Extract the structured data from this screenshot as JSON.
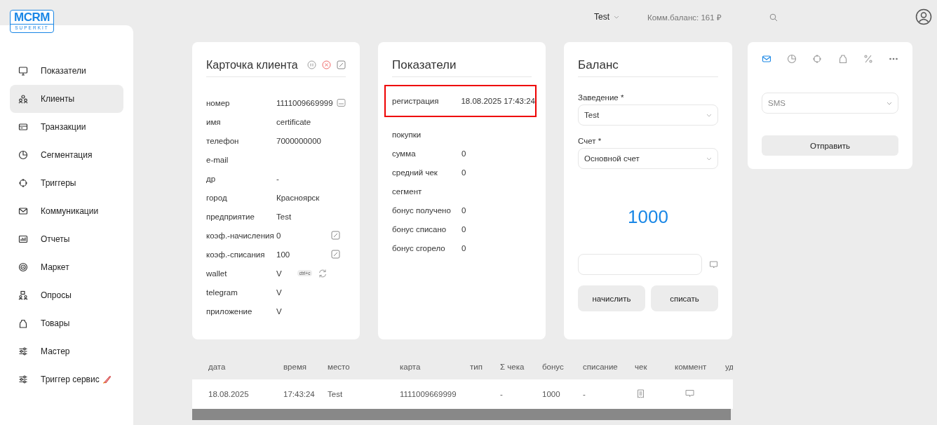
{
  "header": {
    "company": "Test",
    "balance": "Комм.баланс: 161 ₽"
  },
  "logo": {
    "title": "MCRM",
    "subtitle": "SUPERKIT"
  },
  "sidebar": {
    "items": [
      {
        "label": "Показатели",
        "selected": false
      },
      {
        "label": "Клиенты",
        "selected": true
      },
      {
        "label": "Транзакции",
        "selected": false
      },
      {
        "label": "Сегментация",
        "selected": false
      },
      {
        "label": "Триггеры",
        "selected": false
      },
      {
        "label": "Коммуникации",
        "selected": false
      },
      {
        "label": "Отчеты",
        "selected": false
      },
      {
        "label": "Маркет",
        "selected": false
      },
      {
        "label": "Опросы",
        "selected": false
      },
      {
        "label": "Товары",
        "selected": false
      },
      {
        "label": "Мастер",
        "selected": false
      },
      {
        "label": "Триггер сервис",
        "selected": false
      }
    ]
  },
  "client_card": {
    "title": "Карточка клиента",
    "fields": [
      {
        "label": "номер",
        "value": "1111009669999",
        "kind": "card"
      },
      {
        "label": "имя",
        "value": "certificate",
        "kind": "plain"
      },
      {
        "label": "телефон",
        "value": "7000000000",
        "kind": "plain"
      },
      {
        "label": "e-mail",
        "kind": "plain"
      },
      {
        "label": "др",
        "value": "-",
        "kind": "plain"
      },
      {
        "label": "город",
        "value": "Красноярск",
        "kind": "plain"
      },
      {
        "label": "предприятие",
        "value": "Test",
        "kind": "plain"
      },
      {
        "label": "коэф.-начисления",
        "value": "0",
        "kind": "edit"
      },
      {
        "label": "коэф.-списания",
        "value": "100",
        "kind": "edit"
      },
      {
        "label": "wallet",
        "value": "V",
        "kind": "wallet",
        "badge": "ctrl+c"
      },
      {
        "label": "telegram",
        "value": "V",
        "kind": "plain"
      },
      {
        "label": "приложение",
        "value": "V",
        "kind": "plain"
      }
    ]
  },
  "indicators": {
    "title": "Показатели",
    "rows": [
      {
        "label": "регистрация",
        "value": "18.08.2025 17:43:24",
        "highlighted": true
      },
      {
        "label": "покупки",
        "highlighted": false
      },
      {
        "label": "сумма",
        "value": "0",
        "highlighted": false
      },
      {
        "label": "средний чек",
        "value": "0",
        "highlighted": false
      },
      {
        "label": "сегмент",
        "highlighted": false
      },
      {
        "label": "бонус получено",
        "value": "0",
        "highlighted": false
      },
      {
        "label": "бонус списано",
        "value": "0",
        "highlighted": false
      },
      {
        "label": "бонус сгорело",
        "value": "0",
        "highlighted": false
      }
    ]
  },
  "balance": {
    "title": "Баланс",
    "fields": [
      {
        "label": "Заведение *",
        "value": "Test"
      },
      {
        "label": "Счет *",
        "value": "Основной счет"
      }
    ],
    "amount": "1000",
    "buttons": [
      "начислить",
      "списать"
    ]
  },
  "communication": {
    "tabs": [
      {
        "selected": true
      },
      {
        "selected": false
      },
      {
        "selected": false
      },
      {
        "selected": false
      },
      {
        "selected": false
      },
      {
        "selected": false
      }
    ],
    "channel": "SMS",
    "button": "Отправить"
  },
  "table": {
    "columns": [
      "дата",
      "время",
      "место",
      "карта",
      "тип",
      "Σ чека",
      "бонус",
      "списание",
      "чек",
      "коммент",
      "уд"
    ],
    "rows": [
      {
        "date": "18.08.2025",
        "time": "17:43:24",
        "place": "Test",
        "card": "1111009669999",
        "sum": "-",
        "bonus": "1000",
        "writeoff": "-"
      }
    ]
  }
}
